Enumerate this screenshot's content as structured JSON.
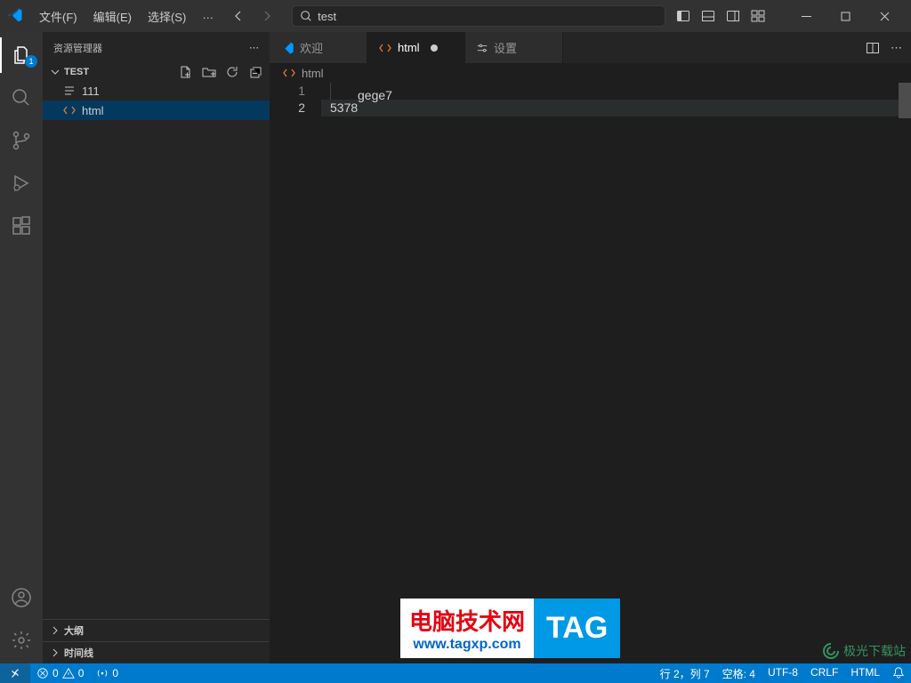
{
  "menu": {
    "file": "文件(F)",
    "edit": "编辑(E)",
    "select": "选择(S)",
    "more": "…"
  },
  "search": {
    "text": "test"
  },
  "activity": {
    "badge": "1"
  },
  "sidebar": {
    "title": "资源管理器",
    "root": "TEST",
    "items": [
      {
        "icon": "lines",
        "label": "111"
      },
      {
        "icon": "code",
        "label": "html"
      }
    ],
    "outline": "大纲",
    "timeline": "时间线"
  },
  "tabs": [
    {
      "icon": "vscode",
      "label": "欢迎",
      "active": false,
      "dirty": false
    },
    {
      "icon": "code",
      "label": "html",
      "active": true,
      "dirty": true
    },
    {
      "icon": "settings",
      "label": "设置",
      "active": false,
      "dirty": false
    }
  ],
  "breadcrumb": {
    "label": "html"
  },
  "editor": {
    "lines": [
      {
        "num": "1",
        "text": "gege7",
        "indented": true
      },
      {
        "num": "2",
        "text": "5378",
        "indented": false
      }
    ],
    "minimap": "--"
  },
  "status": {
    "errors": "0",
    "warnings": "0",
    "ports": "0",
    "line_col": "行 2，列 7",
    "spaces": "空格: 4",
    "encoding": "UTF-8",
    "eol": "CRLF",
    "language": "HTML"
  },
  "watermark": {
    "l1": "电脑技术网",
    "l2": "www.tagxp.com",
    "r": "TAG",
    "corner": "极光下载站"
  }
}
